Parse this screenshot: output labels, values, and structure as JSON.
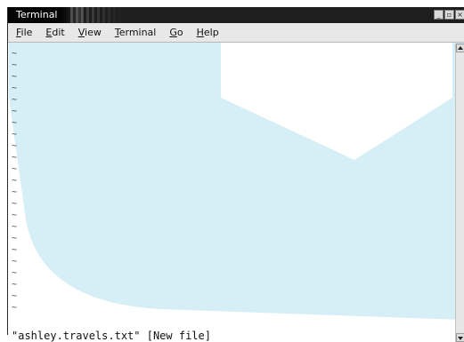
{
  "window": {
    "title": "Terminal",
    "controls": {
      "minimize": "_",
      "maximize": "▫",
      "close": "×"
    }
  },
  "menubar": {
    "items": [
      {
        "mnemonic": "F",
        "rest": "ile"
      },
      {
        "mnemonic": "E",
        "rest": "dit"
      },
      {
        "mnemonic": "V",
        "rest": "iew"
      },
      {
        "mnemonic": "T",
        "rest": "erminal"
      },
      {
        "mnemonic": "G",
        "rest": "o"
      },
      {
        "mnemonic": "H",
        "rest": "elp"
      }
    ]
  },
  "editor": {
    "empty_line_marker": "~",
    "empty_line_count": 23,
    "status_line": "\"ashley.travels.txt\" [New file]"
  },
  "colors": {
    "titlebar": "#1e1e1e",
    "watermark": "#d6eef5",
    "menubar": "#e8e8e8"
  },
  "icons": {
    "scroll_up": "triangle-up",
    "scroll_down": "triangle-down"
  }
}
